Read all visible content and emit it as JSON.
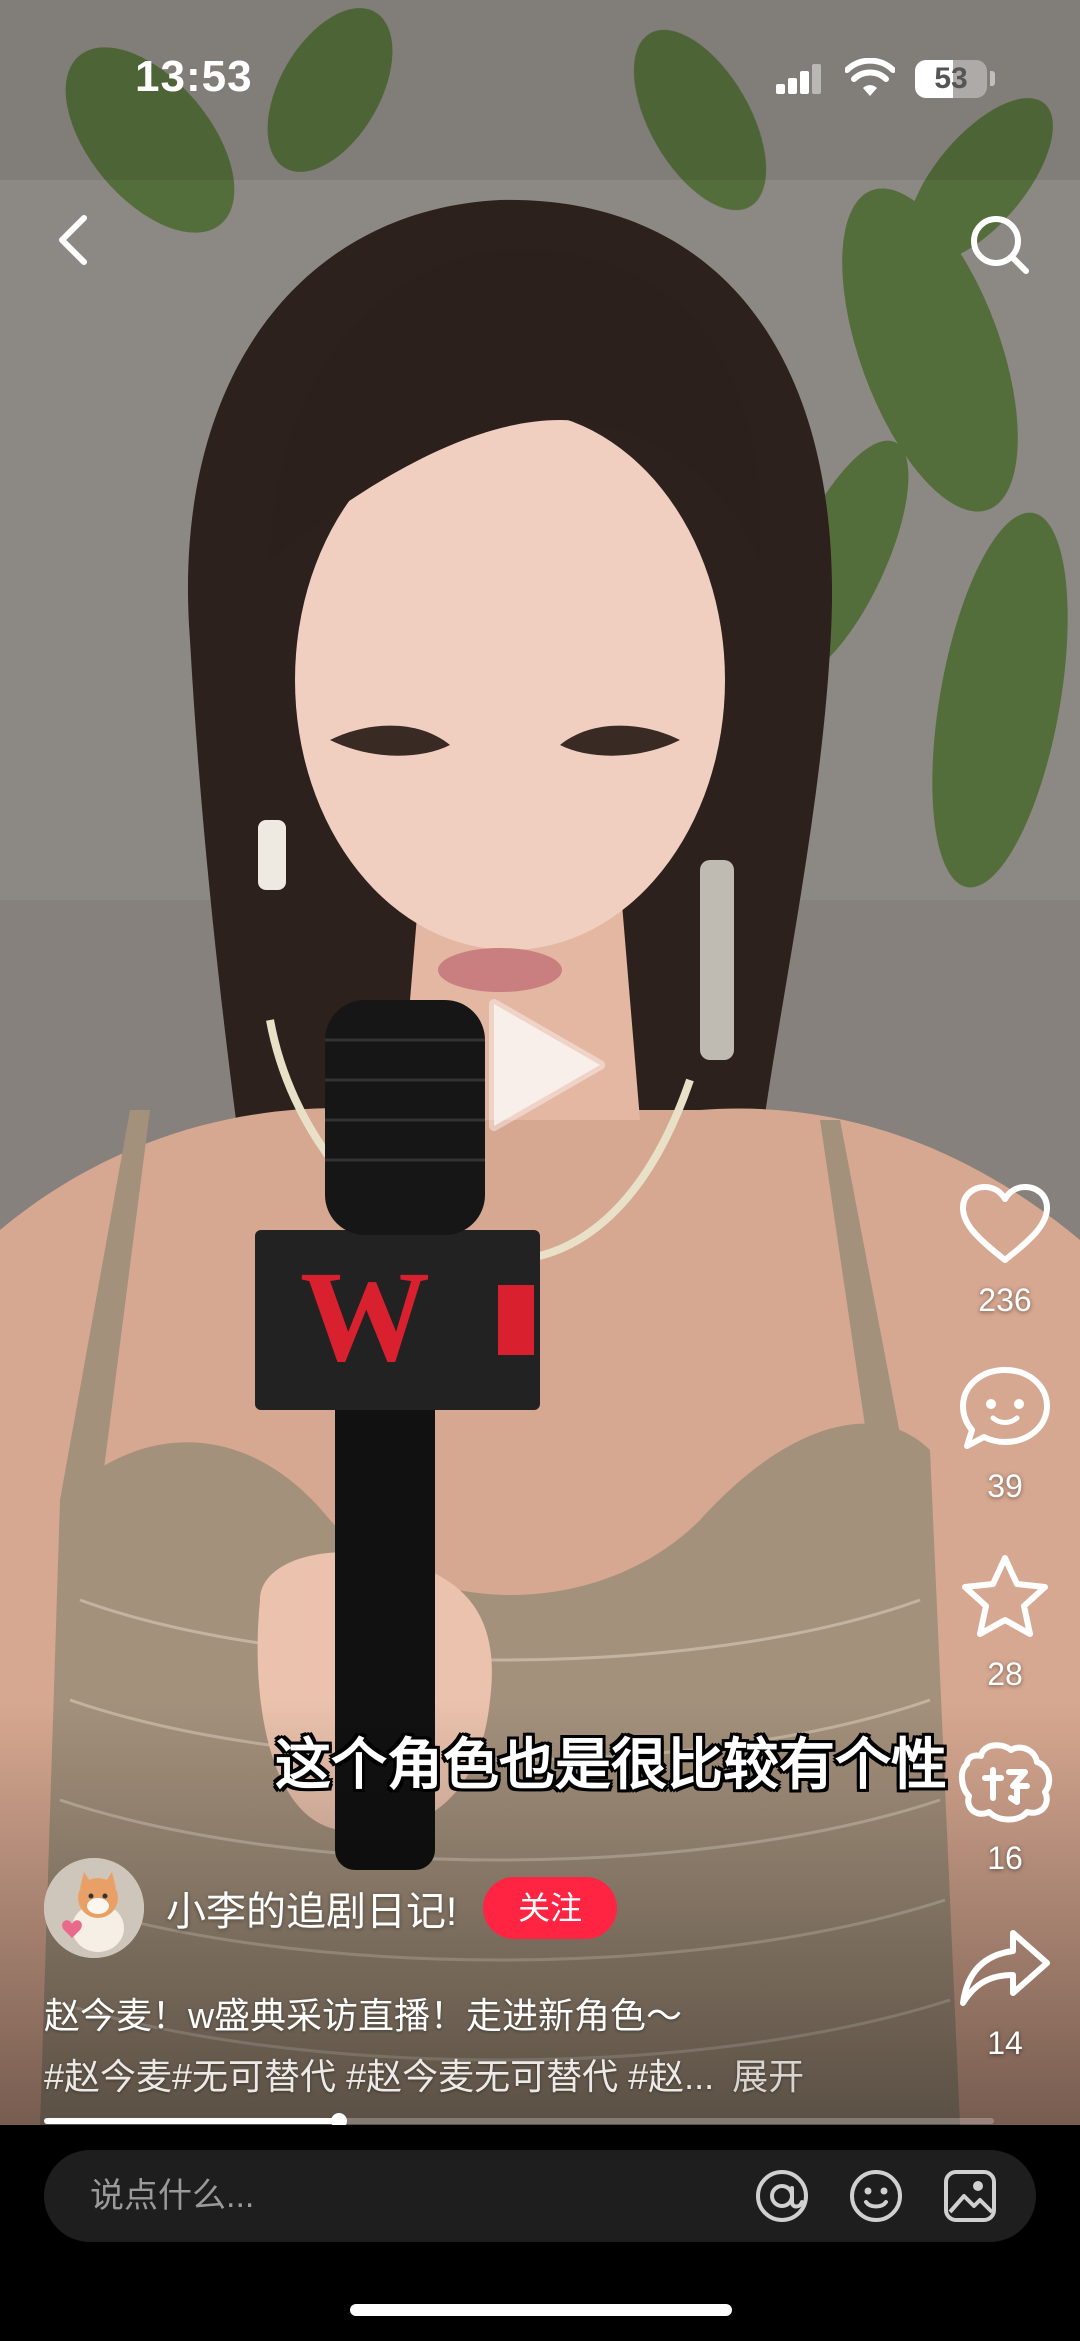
{
  "status": {
    "time": "13:53",
    "battery": "53",
    "battery_level": 0.53
  },
  "video": {
    "subtitle": "这个角色也是很比较有个性",
    "progress": 0.31,
    "mic_logo": "W"
  },
  "actions": {
    "like_count": "236",
    "comment_count": "39",
    "favorite_count": "28",
    "share_friend_count": "16",
    "share_count": "14"
  },
  "author": {
    "name": "小李的追剧日记!",
    "follow_label": "关注"
  },
  "post": {
    "caption": "赵今麦！w盛典采访直播！走进新角色～",
    "tags": [
      "#赵今麦",
      "#无可替代",
      "#赵今麦无可替代",
      "#赵..."
    ],
    "expand_label": "展开"
  },
  "input": {
    "placeholder": "说点什么..."
  },
  "colors": {
    "accent": "#ff2442",
    "input_bg": "#1e1e1e"
  }
}
